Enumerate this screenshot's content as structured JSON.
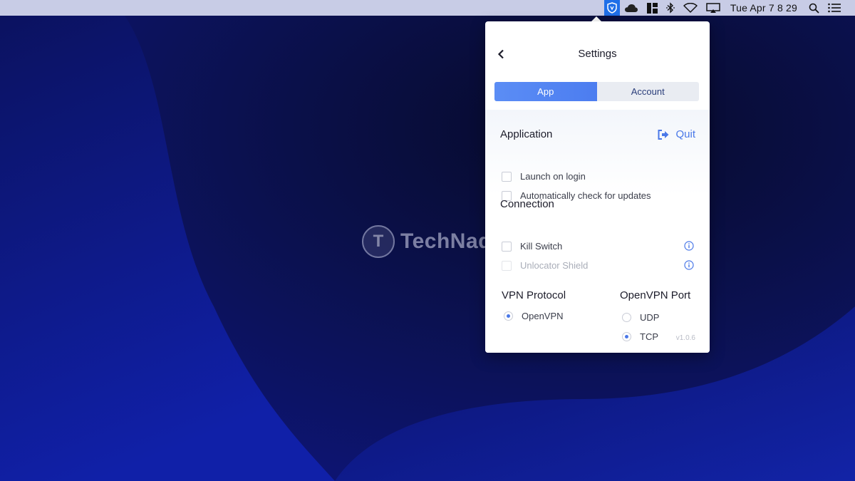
{
  "menubar": {
    "clock": "Tue Apr 7  8 29",
    "icons": [
      "vpn-shield-icon",
      "cloud-icon",
      "grid-layout-icon",
      "bluetooth-icon",
      "wifi-icon",
      "airplay-icon",
      "search-icon",
      "list-icon"
    ]
  },
  "watermark": {
    "badge": "T",
    "text": "TechNadu"
  },
  "popup": {
    "title": "Settings",
    "tabs": [
      {
        "label": "App",
        "active": true
      },
      {
        "label": "Account",
        "active": false
      }
    ],
    "application": {
      "title": "Application",
      "quit_label": "Quit",
      "options": [
        {
          "label": "Launch on login",
          "checked": false
        },
        {
          "label": "Automatically check for updates",
          "checked": false
        }
      ]
    },
    "connection": {
      "title": "Connection",
      "options": [
        {
          "label": "Kill Switch",
          "checked": false,
          "disabled": false
        },
        {
          "label": "Unlocator Shield",
          "checked": false,
          "disabled": true
        }
      ]
    },
    "vpn_protocol": {
      "title": "VPN Protocol",
      "options": [
        {
          "label": "OpenVPN",
          "selected": true
        }
      ]
    },
    "openvpn_port": {
      "title": "OpenVPN Port",
      "options": [
        {
          "label": "UDP",
          "selected": false
        },
        {
          "label": "TCP",
          "selected": true
        }
      ]
    },
    "version": "v1.0.6"
  },
  "colors": {
    "accent": "#4a78e8",
    "menubar": "#c8cce6",
    "vpn_icon_bg": "#1f6fe8"
  }
}
